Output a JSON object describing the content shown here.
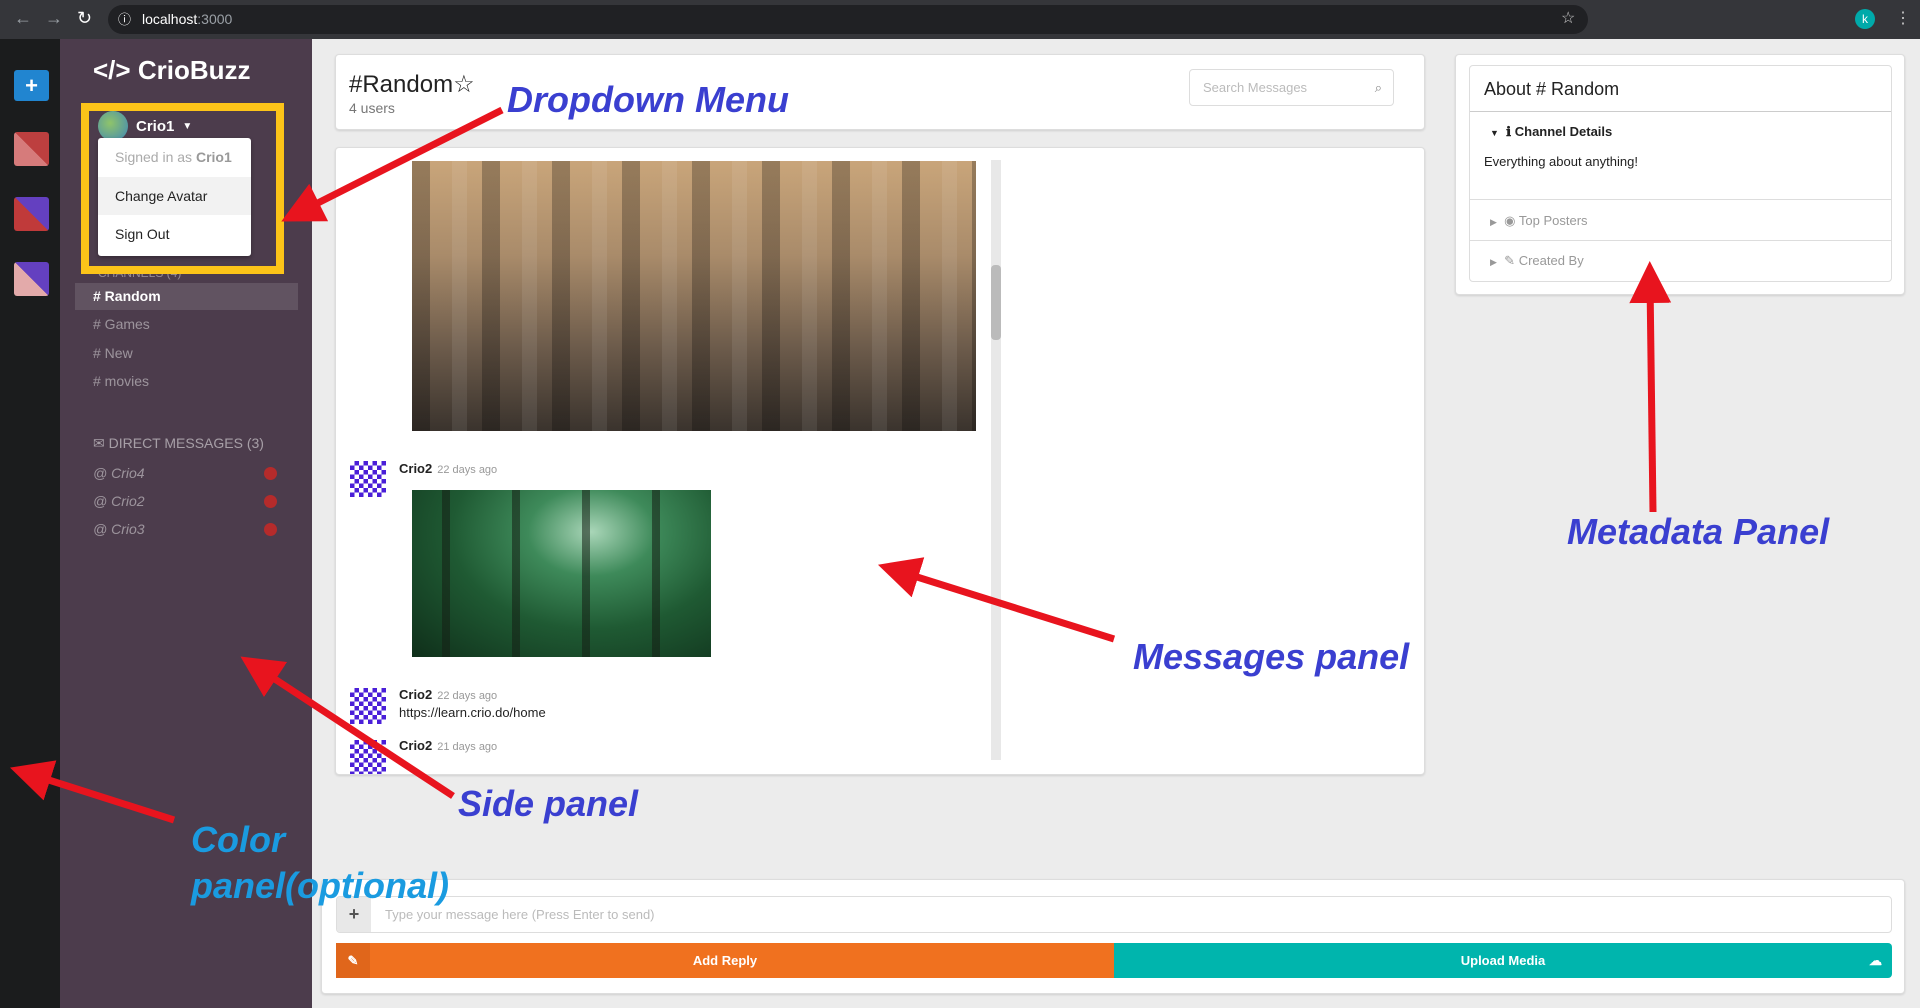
{
  "browser": {
    "url_host": "localhost",
    "url_port": ":3000"
  },
  "app": {
    "name": "CrioBuzz"
  },
  "user": {
    "name": "Crio1",
    "menu": {
      "signed_in_prefix": "Signed in as ",
      "signed_in_user": "Crio1",
      "items": [
        "Change Avatar",
        "Sign Out"
      ]
    }
  },
  "sidebar": {
    "channels_header": "CHANNELS (4)",
    "channels": [
      "# Random",
      "# Games",
      "# New",
      "# movies"
    ],
    "active_channel": 0,
    "dm_header": "DIRECT MESSAGES (3)",
    "dms": [
      "@ Crio4",
      "@ Crio2",
      "@ Crio3"
    ],
    "dm_status_color": "#b52b2b"
  },
  "colors": {
    "sidebar": "#4c3c4c",
    "accent_orange": "#f0711f",
    "accent_teal": "#00b5ad"
  },
  "header": {
    "channel": "#Random",
    "users": "4 users",
    "search_placeholder": "Search Messages"
  },
  "messages": [
    {
      "user": "Crio2",
      "time": "22 days ago",
      "image": "forest"
    },
    {
      "user": "Crio2",
      "time": "22 days ago",
      "text": "https://learn.crio.do/home"
    },
    {
      "user": "Crio2",
      "time": "21 days ago"
    }
  ],
  "metadata": {
    "title": "About # Random",
    "details_title": "Channel Details",
    "description": "Everything about anything!",
    "top_posters": "Top Posters",
    "created_by": "Created By"
  },
  "form": {
    "placeholder": "Type your message here (Press Enter to send)",
    "add_reply": "Add Reply",
    "upload_media": "Upload Media"
  },
  "annotations": {
    "dropdown": "Dropdown Menu",
    "metadata": "Metadata Panel",
    "messages": "Messages panel",
    "side": "Side panel",
    "color_1": "Color",
    "color_2": "panel(optional)"
  }
}
